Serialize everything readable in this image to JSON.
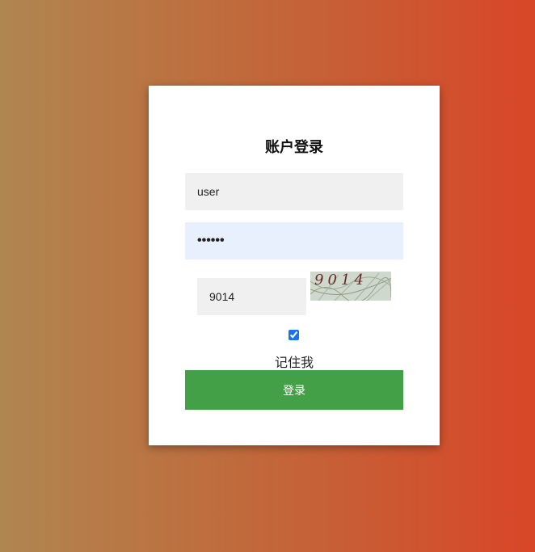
{
  "login": {
    "title": "账户登录",
    "username_value": "user",
    "password_value": "••••••",
    "captcha_value": "9014",
    "captcha_image_text": "9014",
    "remember_label": "记住我",
    "remember_checked": true,
    "submit_label": "登录"
  },
  "colors": {
    "background_gradient_start": "#b08650",
    "background_gradient_end": "#d84628",
    "card": "#ffffff",
    "input_bg": "#f0f0f0",
    "password_bg": "#e8f0fe",
    "button": "#43a047",
    "checkbox_accent": "#1a73e8"
  }
}
